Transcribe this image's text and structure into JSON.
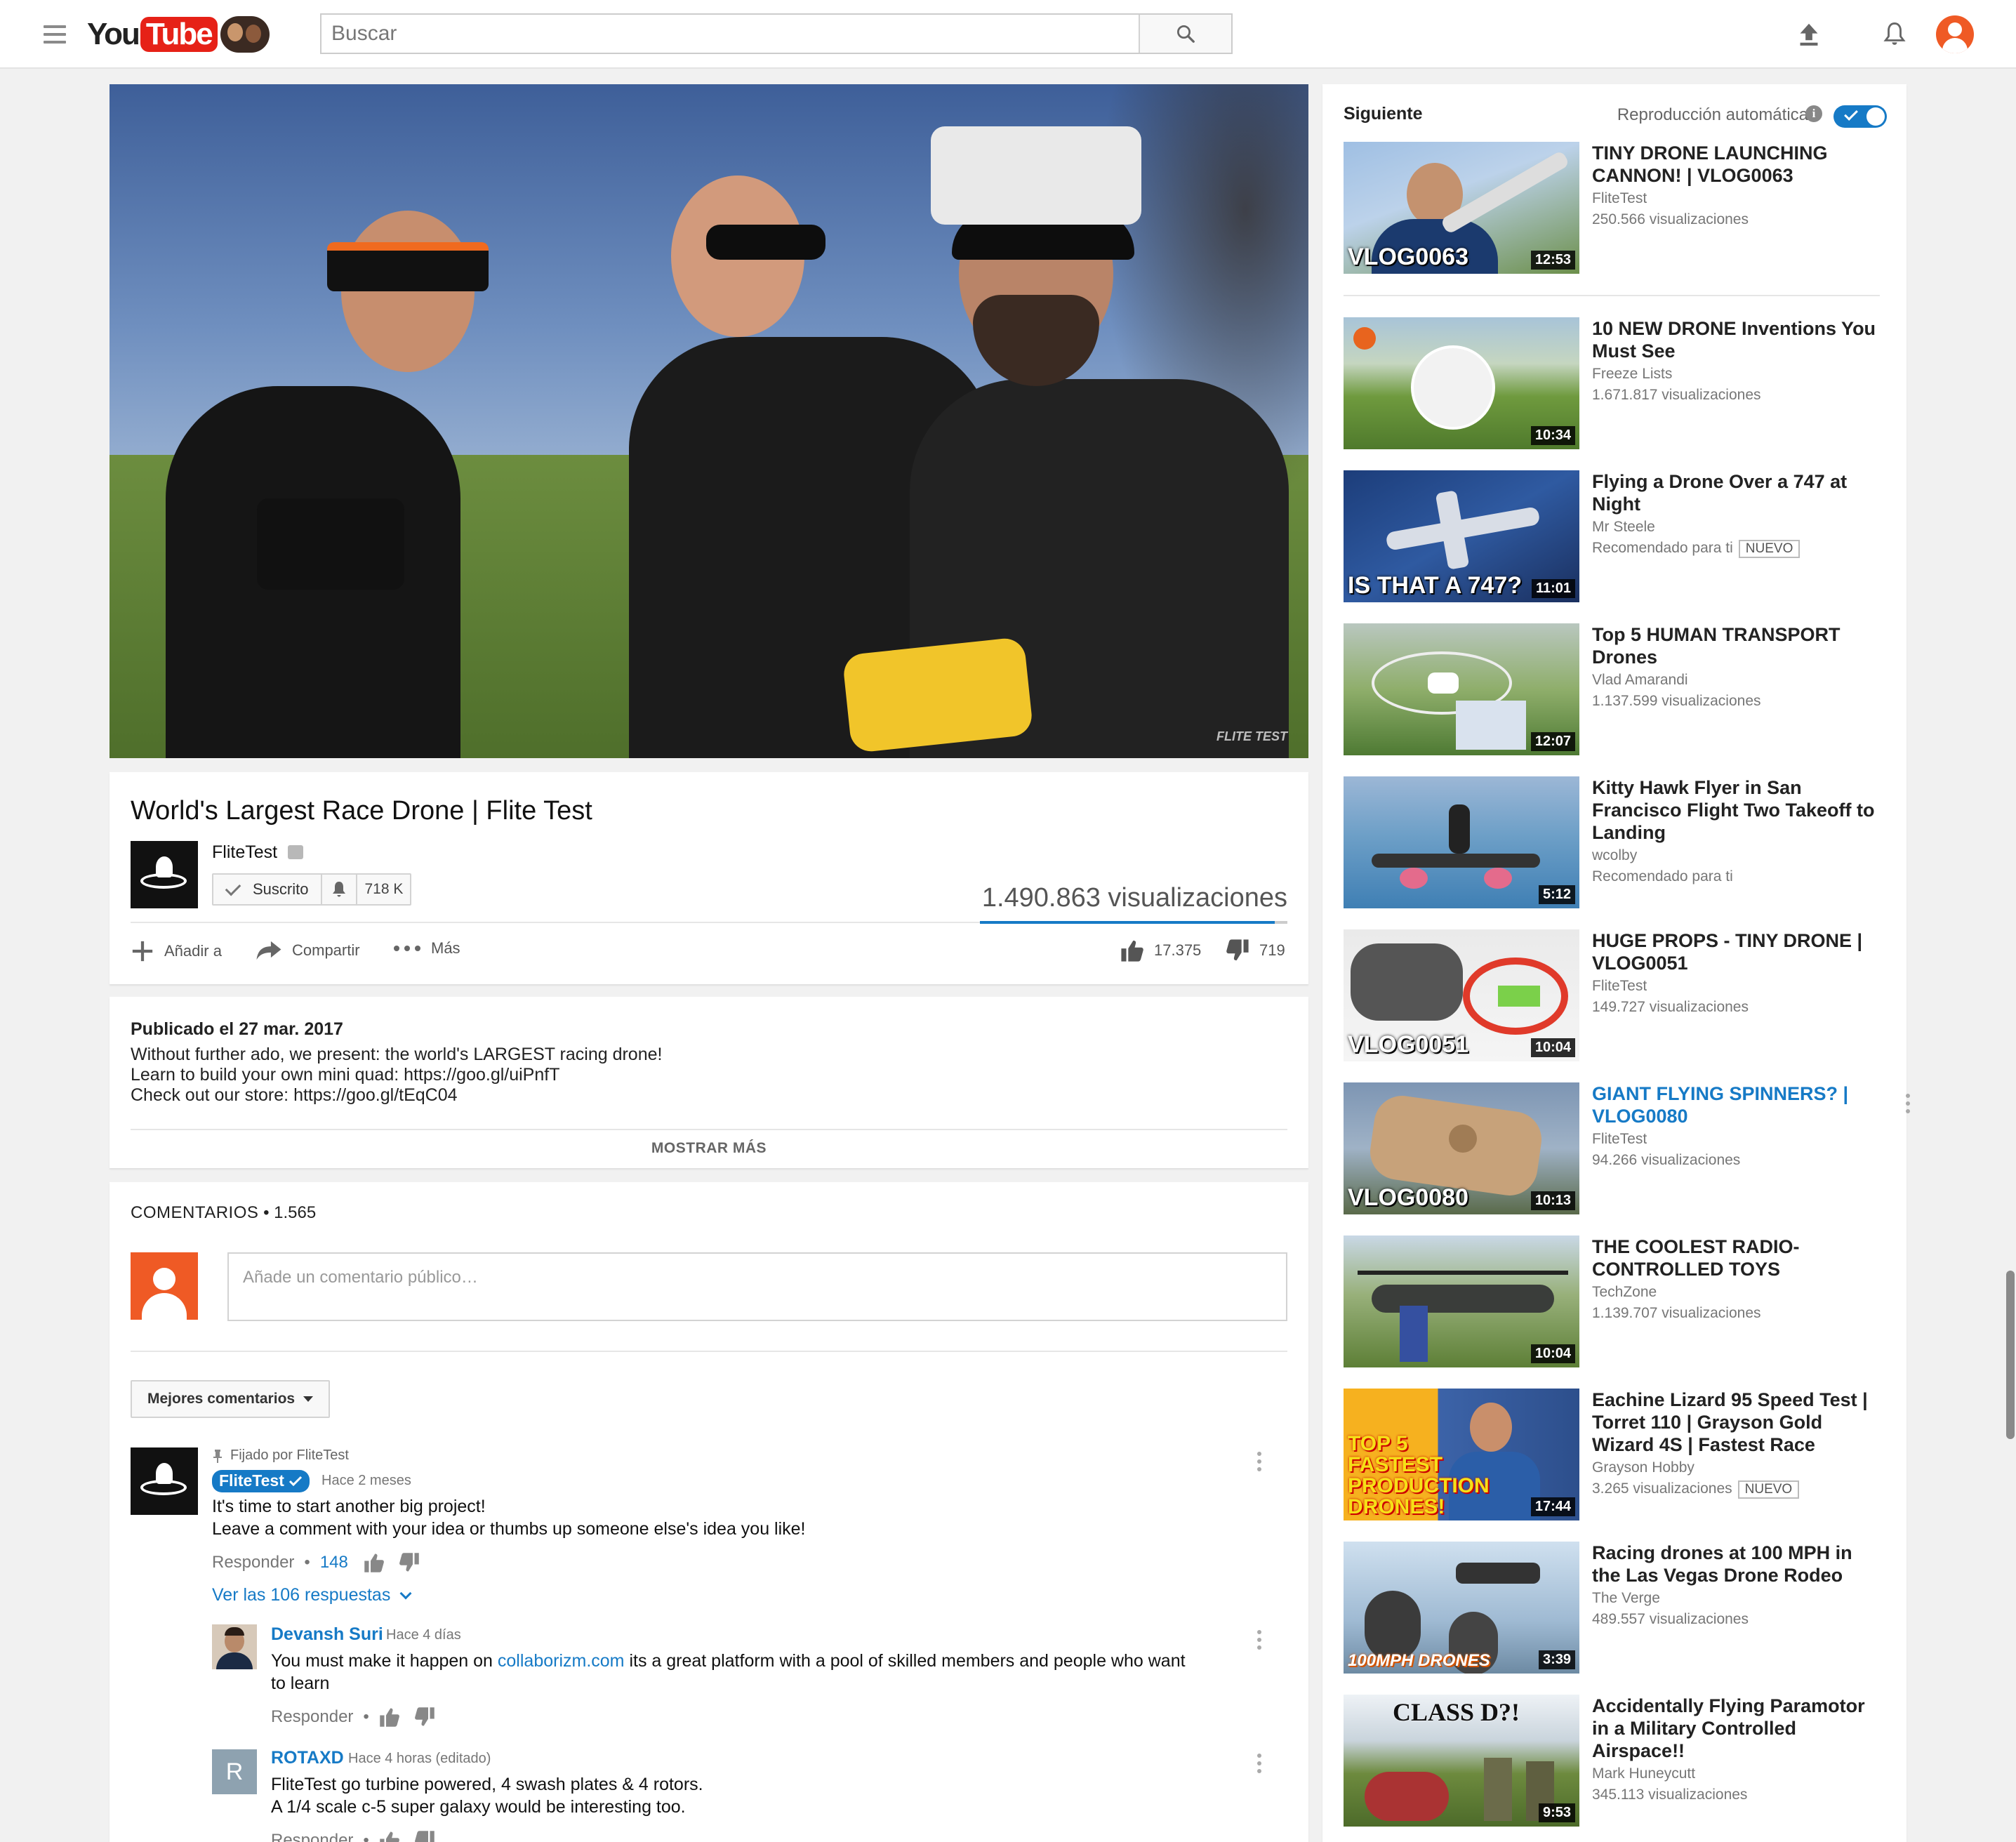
{
  "header": {
    "logo_you": "You",
    "logo_tube": "Tube",
    "search_placeholder": "Buscar",
    "icons": [
      "menu-icon",
      "search-icon",
      "upload-icon",
      "bell-icon",
      "account-icon"
    ]
  },
  "video": {
    "watermark": "FLITE TEST",
    "title": "World's Largest Race Drone | Flite Test",
    "channel": "FliteTest",
    "subscribe_label": "Suscrito",
    "subscriber_count": "718 K",
    "views": "1.490.863 visualizaciones",
    "like_ratio": 0.96,
    "actions": {
      "add_to": "Añadir a",
      "share": "Compartir",
      "more": "Más"
    },
    "likes": "17.375",
    "dislikes": "719"
  },
  "description": {
    "published": "Publicado el 27 mar. 2017",
    "line1": "Without further ado, we present: the world's LARGEST racing drone!",
    "line2_prefix": "Learn to build your own mini quad: ",
    "line2_link": "https://goo.gl/uiPnfT",
    "line3_prefix": "Check out our store: ",
    "line3_link": "https://goo.gl/tEqC04",
    "show_more": "MOSTRAR MÁS"
  },
  "comments": {
    "heading": "COMENTARIOS",
    "count": "1.565",
    "placeholder": "Añade un comentario público…",
    "sort_label": "Mejores comentarios",
    "pinned": {
      "pinned_by": "Fijado por FliteTest",
      "author": "FliteTest",
      "time": "Hace 2 meses",
      "text1": "It's time to start another big project!",
      "text2": "Leave a comment with your idea or thumbs up someone else's idea you like!",
      "reply_label": "Responder",
      "likes": "148",
      "view_replies": "Ver las 106 respuestas"
    },
    "replies": [
      {
        "author": "Devansh Suri",
        "time": "Hace 4 días",
        "text_prefix": "You must make it happen on ",
        "text_link": "collaborizm.com",
        "text_suffix": " its a great platform with a pool of skilled members and people who want",
        "text_line2": "to learn",
        "reply_label": "Responder"
      },
      {
        "author": "ROTAXD",
        "avatar_letter": "R",
        "time": "Hace 4 horas (editado)",
        "text1": "FliteTest go turbine powered, 4 swash plates & 4 rotors.",
        "text2": "A 1/4 scale c-5 super galaxy would be interesting too.",
        "reply_label": "Responder"
      }
    ]
  },
  "sidebar": {
    "up_next": "Siguiente",
    "autoplay": "Reproducción automática",
    "autoplay_on": true,
    "items": [
      {
        "title": "TINY DRONE LAUNCHING CANNON! | VLOG0063",
        "channel": "FliteTest",
        "meta": "250.566 visualizaciones",
        "duration": "12:53",
        "thumb_text": "VLOG0063"
      },
      {
        "title": "10 NEW DRONE Inventions You Must See",
        "channel": "Freeze Lists",
        "meta": "1.671.817 visualizaciones",
        "duration": "10:34",
        "thumb_text": ""
      },
      {
        "title": "Flying a Drone Over a 747 at Night",
        "channel": "Mr Steele",
        "meta": "Recomendado para ti",
        "badge": "NUEVO",
        "duration": "11:01",
        "thumb_text": "IS THAT A 747?"
      },
      {
        "title": "Top 5 HUMAN TRANSPORT Drones",
        "channel": "Vlad Amarandi",
        "meta": "1.137.599 visualizaciones",
        "duration": "12:07",
        "thumb_text": ""
      },
      {
        "title": "Kitty Hawk Flyer in San Francisco Flight Two Takeoff to Landing",
        "channel": "wcolby",
        "meta": "Recomendado para ti",
        "duration": "5:12",
        "thumb_text": ""
      },
      {
        "title": "HUGE PROPS - TINY DRONE | VLOG0051",
        "channel": "FliteTest",
        "meta": "149.727 visualizaciones",
        "duration": "10:04",
        "thumb_text": "VLOG0051"
      },
      {
        "title": "GIANT FLYING SPINNERS? | VLOG0080",
        "channel": "FliteTest",
        "meta": "94.266 visualizaciones",
        "duration": "10:13",
        "thumb_text": "VLOG0080"
      },
      {
        "title": "THE COOLEST RADIO-CONTROLLED TOYS",
        "channel": "TechZone",
        "meta": "1.139.707 visualizaciones",
        "duration": "10:04",
        "thumb_text": ""
      },
      {
        "title": "Eachine Lizard 95 Speed Test | Torret 110 | Grayson Gold Wizard 4S | Fastest Race",
        "channel": "Grayson Hobby",
        "meta": "3.265 visualizaciones",
        "badge": "NUEVO",
        "duration": "17:44",
        "thumb_text": "TOP 5 FASTEST PRODUCTION DRONES!"
      },
      {
        "title": "Racing drones at 100 MPH in the Las Vegas Drone Rodeo",
        "channel": "The Verge",
        "meta": "489.557 visualizaciones",
        "duration": "3:39",
        "thumb_text": "100MPH DRONES"
      },
      {
        "title": "Accidentally Flying Paramotor in a Military Controlled Airspace!!",
        "channel": "Mark Huneycutt",
        "meta": "345.113 visualizaciones",
        "duration": "9:53",
        "thumb_text": "CLASS D?!"
      }
    ]
  },
  "colors": {
    "brand_red": "#e62117",
    "link_blue": "#167ac6",
    "avatar_orange": "#ef5a25"
  }
}
